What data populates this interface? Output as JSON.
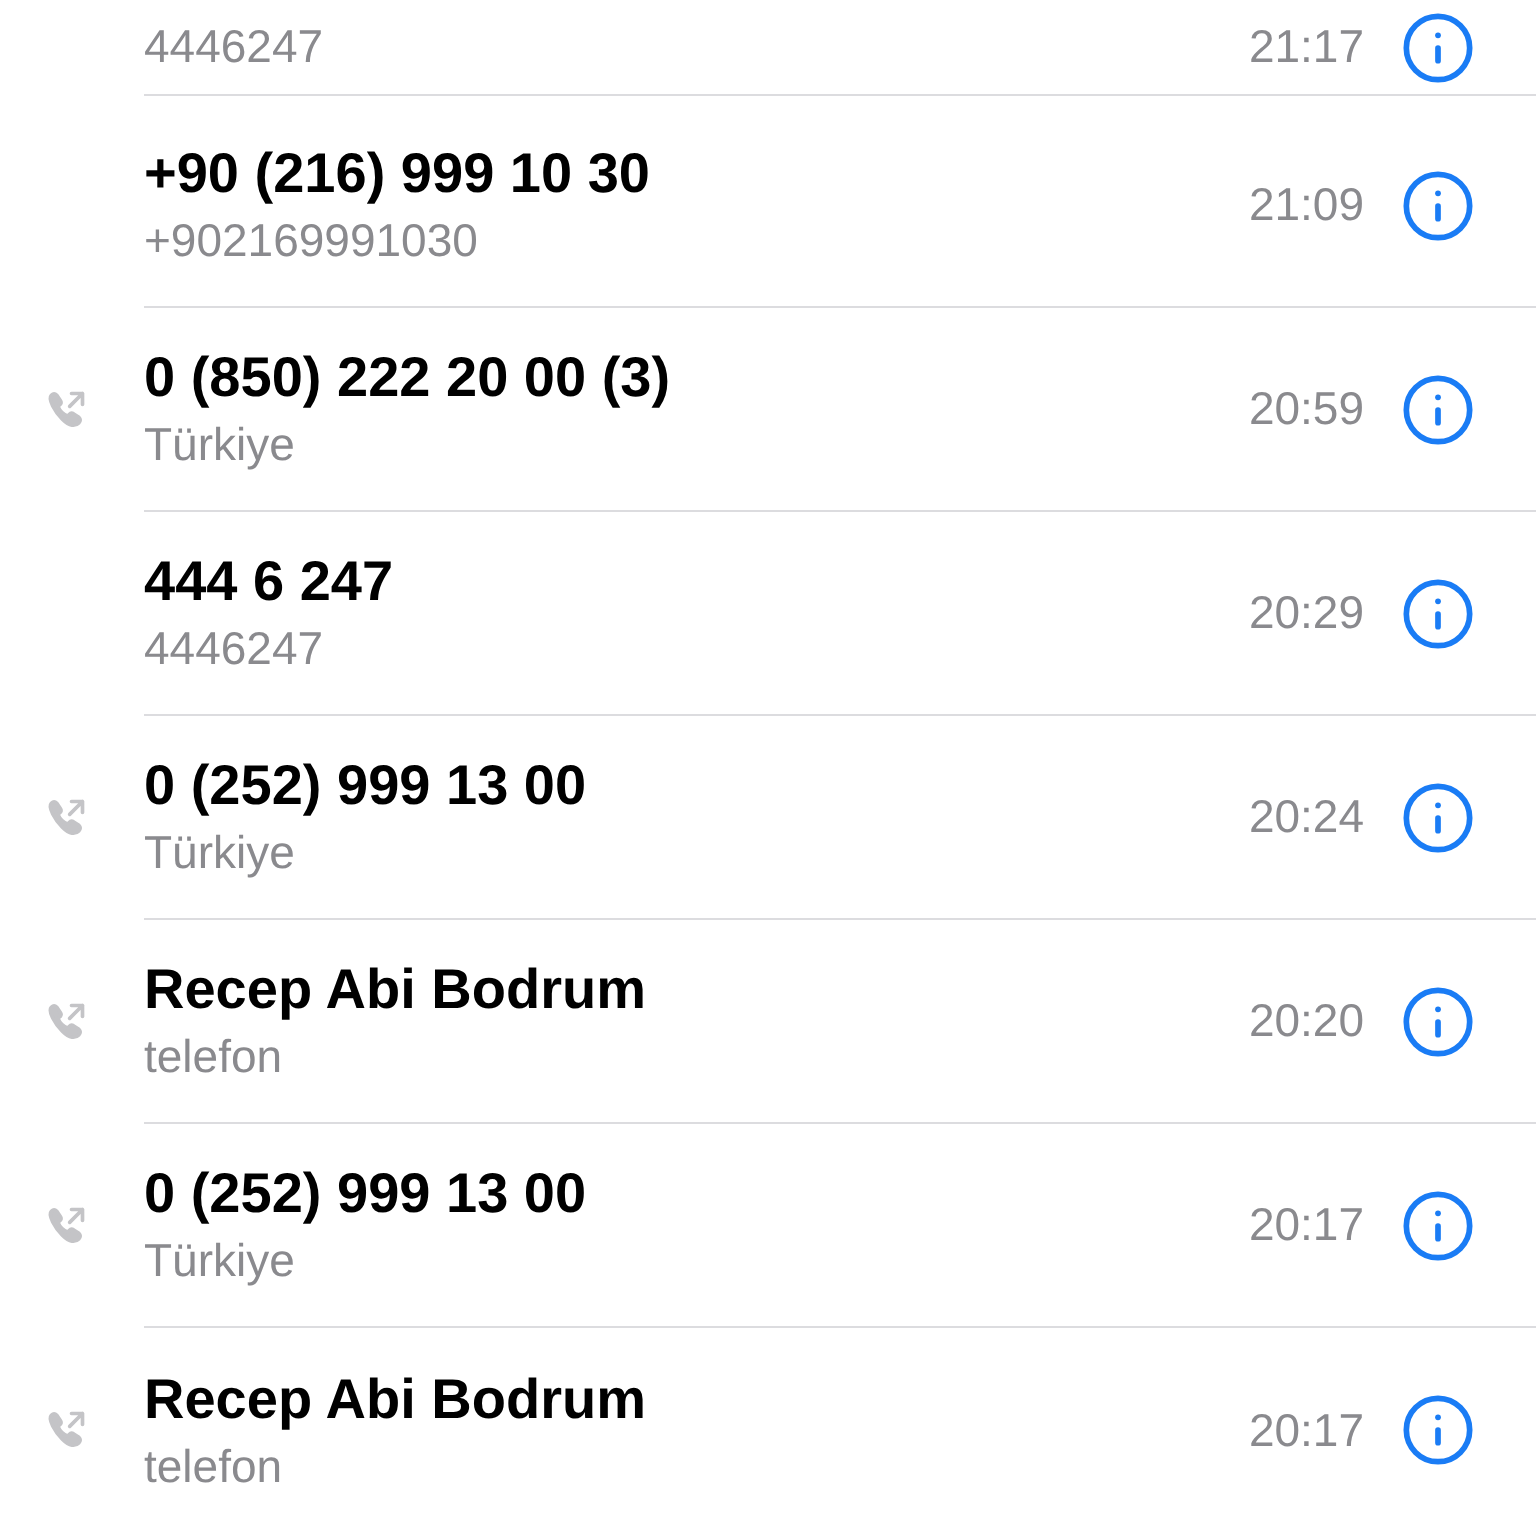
{
  "calls": [
    {
      "detail": "4446247",
      "time": "21:17",
      "outgoing": false
    },
    {
      "name": "+90 (216) 999 10 30",
      "detail": "+902169991030",
      "time": "21:09",
      "outgoing": false
    },
    {
      "name": "0 (850) 222 20 00 (3)",
      "detail": "Türkiye",
      "time": "20:59",
      "outgoing": true
    },
    {
      "name": "444 6 247",
      "detail": "4446247",
      "time": "20:29",
      "outgoing": false
    },
    {
      "name": "0 (252) 999 13 00",
      "detail": "Türkiye",
      "time": "20:24",
      "outgoing": true
    },
    {
      "name": "Recep Abi Bodrum",
      "detail": "telefon",
      "time": "20:20",
      "outgoing": true
    },
    {
      "name": "0 (252) 999 13 00",
      "detail": "Türkiye",
      "time": "20:17",
      "outgoing": true
    },
    {
      "name": "Recep Abi Bodrum",
      "detail": "telefon",
      "time": "20:17",
      "outgoing": true
    }
  ]
}
